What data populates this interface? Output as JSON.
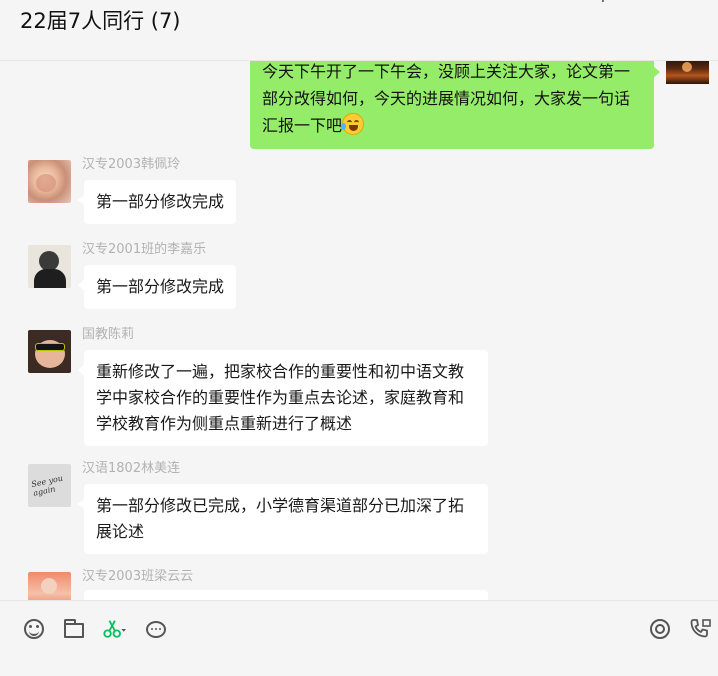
{
  "header": {
    "title": "22届7人同行 (7)",
    "icons": [
      "add-icon",
      "more-icon"
    ]
  },
  "my_message": {
    "text": "今天下午开了一下午会，没顾上关注大家，论文第一部分改得如何，今天的进展情况如何，大家发一句话汇报一下吧",
    "emoji": "laugh-cry-emoji-icon"
  },
  "messages": [
    {
      "sender": "汉专2003韩佩玲",
      "text": "第一部分修改完成"
    },
    {
      "sender": "汉专2001班的李嘉乐",
      "text": "第一部分修改完成"
    },
    {
      "sender": "国教陈莉",
      "text": "重新修改了一遍，把家校合作的重要性和初中语文教学中家校合作的重要性作为重点去论述，家庭教育和学校教育作为侧重点重新进行了概述"
    },
    {
      "sender": "汉语1802林美连",
      "text": "第一部分修改已完成，小学德育渠道部分已加深了拓展论述"
    },
    {
      "sender": "汉专2003班梁云云",
      "text": ""
    }
  ],
  "avatars": {
    "av4_text": "See you again"
  },
  "toolbar": {
    "left_icons": [
      "emoji-icon",
      "folder-icon",
      "scissors-icon",
      "chat-history-icon"
    ],
    "right_icons": [
      "live-icon",
      "call-icon"
    ],
    "accent_color": "#07c160"
  },
  "colors": {
    "my_bubble": "#95ec69",
    "other_bubble": "#ffffff",
    "background": "#f5f5f5",
    "sender_text": "#b2b2b2"
  }
}
